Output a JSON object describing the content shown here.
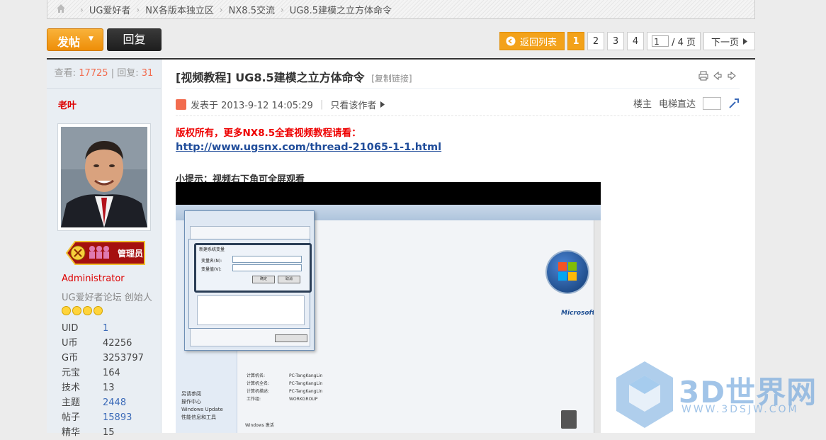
{
  "breadcrumb": {
    "items": [
      "UG爱好者",
      "NX各版本独立区",
      "NX8.5交流",
      "UG8.5建模之立方体命令"
    ],
    "separator": "›"
  },
  "actions": {
    "post_label": "发帖",
    "reply_label": "回复"
  },
  "pager": {
    "back_label": "返回列表",
    "pages": [
      "1",
      "2",
      "3",
      "4"
    ],
    "current": "1",
    "jump_value": "1",
    "total_label": "/ 4 页",
    "next_label": "下一页"
  },
  "stats": {
    "views_label": "查看:",
    "views": "17725",
    "divider": "|",
    "replies_label": "回复:",
    "replies": "31"
  },
  "author": {
    "name": "老叶",
    "badge_text": "管理员",
    "role": "Administrator",
    "title": "UG爱好者论坛 创始人",
    "info": [
      {
        "k": "UID",
        "v": "1",
        "link": true
      },
      {
        "k": "U币",
        "v": "42256",
        "link": false
      },
      {
        "k": "G币",
        "v": "3253797",
        "link": false
      },
      {
        "k": "元宝",
        "v": "164",
        "link": false
      },
      {
        "k": "技术",
        "v": "13",
        "link": false
      },
      {
        "k": "主题",
        "v": "2448",
        "link": true
      },
      {
        "k": "帖子",
        "v": "15893",
        "link": true
      },
      {
        "k": "精华",
        "v": "15",
        "link": false
      }
    ]
  },
  "thread": {
    "title": "[视频教程] UG8.5建模之立方体命令",
    "copy_link": "[复制链接]"
  },
  "meta": {
    "posted": "发表于 2013-9-12 14:05:29",
    "only_author": "只看该作者",
    "floor": "楼主",
    "elevator": "电梯直达"
  },
  "post": {
    "copyright": "版权所有，更多NX8.5全套视频教程请看：",
    "url": "http://www.ugsnx.com/thread-21065-1-1.html",
    "tip": "小提示：视频右下角可全屏观看"
  },
  "video_screen": {
    "dialog_title": "新建系统变量",
    "var_name_label": "变量名(N):",
    "var_value_label": "变量值(V):",
    "ok": "确定",
    "cancel": "取消",
    "brand": "Microsoft",
    "side_items": [
      "另请参阅",
      "操作中心",
      "Windows Update",
      "性能信息和工具"
    ],
    "comp_rows": [
      {
        "k": "计算机名:",
        "v": "PC-TangKangLin"
      },
      {
        "k": "计算机全名:",
        "v": "PC-TangKangLin"
      },
      {
        "k": "计算机描述:",
        "v": "PC-TangKangLin"
      },
      {
        "k": "工作组:",
        "v": "WORKGROUP"
      }
    ],
    "activation": "Windows 激活"
  },
  "watermark": {
    "text": "3D世界网",
    "sub": "WWW.3DSJW.COM"
  },
  "colors": {
    "accent_orange": "#f3a21a",
    "admin_red": "#dd0000",
    "link_blue": "#1f4c9a"
  }
}
